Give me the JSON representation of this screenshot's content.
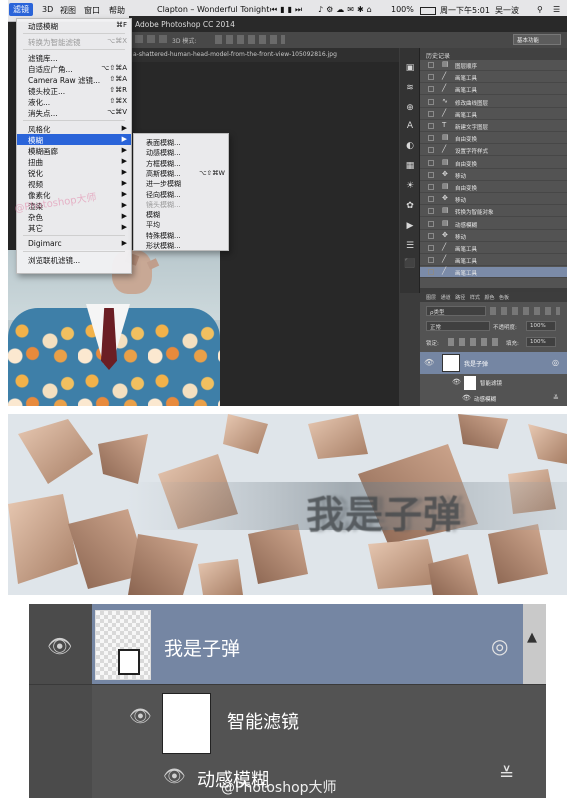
{
  "menubar": {
    "items": [
      "滤镜",
      "3D",
      "视图",
      "窗口",
      "帮助"
    ],
    "now_playing": "Clapton – Wonderful Tonight",
    "battery": "100%",
    "clock": "周一下午5:01",
    "user": "吴一波"
  },
  "window": {
    "title": "Adobe Photoshop CC 2014",
    "mode": "3D 模式:",
    "workspace": "基本功能",
    "doc_tab": "a-shattered-human-head-model-from-the-front-view-105092816.jpg"
  },
  "filter_menu": {
    "items": [
      {
        "label": "动感模糊",
        "shortcut": "⌘F",
        "state": "normal"
      },
      {
        "separator": true
      },
      {
        "label": "转换为智能滤镜",
        "shortcut": "⌥⌘X",
        "state": "disabled"
      },
      {
        "separator": true
      },
      {
        "label": "滤镜库...",
        "shortcut": "",
        "state": "normal"
      },
      {
        "label": "自适应广角...",
        "shortcut": "⌥⇧⌘A",
        "state": "normal"
      },
      {
        "label": "Camera Raw 滤镜...",
        "shortcut": "⇧⌘A",
        "state": "normal"
      },
      {
        "label": "镜头校正...",
        "shortcut": "⇧⌘R",
        "state": "normal"
      },
      {
        "label": "液化...",
        "shortcut": "⇧⌘X",
        "state": "normal"
      },
      {
        "label": "消失点...",
        "shortcut": "⌥⌘V",
        "state": "normal"
      },
      {
        "separator": true
      },
      {
        "label": "风格化",
        "shortcut": "▶",
        "state": "normal"
      },
      {
        "label": "模糊",
        "shortcut": "▶",
        "state": "highlighted"
      },
      {
        "label": "模糊画廊",
        "shortcut": "▶",
        "state": "normal"
      },
      {
        "label": "扭曲",
        "shortcut": "▶",
        "state": "normal"
      },
      {
        "label": "锐化",
        "shortcut": "▶",
        "state": "normal"
      },
      {
        "label": "视频",
        "shortcut": "▶",
        "state": "normal"
      },
      {
        "label": "像素化",
        "shortcut": "▶",
        "state": "normal"
      },
      {
        "label": "渲染",
        "shortcut": "▶",
        "state": "normal"
      },
      {
        "label": "杂色",
        "shortcut": "▶",
        "state": "normal"
      },
      {
        "label": "其它",
        "shortcut": "▶",
        "state": "normal"
      },
      {
        "separator": true
      },
      {
        "label": "Digimarc",
        "shortcut": "▶",
        "state": "normal"
      },
      {
        "separator": true
      },
      {
        "label": "浏览联机滤镜...",
        "shortcut": "",
        "state": "normal"
      }
    ]
  },
  "blur_submenu": {
    "items": [
      {
        "label": "表面模糊...",
        "shortcut": "",
        "state": "normal"
      },
      {
        "label": "动感模糊...",
        "shortcut": "",
        "state": "normal"
      },
      {
        "label": "方框模糊...",
        "shortcut": "",
        "state": "normal"
      },
      {
        "label": "高斯模糊...",
        "shortcut": "⌥⇧⌘W",
        "state": "normal"
      },
      {
        "label": "进一步模糊",
        "shortcut": "",
        "state": "normal"
      },
      {
        "label": "径向模糊...",
        "shortcut": "",
        "state": "normal"
      },
      {
        "label": "镜头模糊...",
        "shortcut": "",
        "state": "disabled"
      },
      {
        "label": "模糊",
        "shortcut": "",
        "state": "normal"
      },
      {
        "label": "平均",
        "shortcut": "",
        "state": "normal"
      },
      {
        "label": "特殊模糊...",
        "shortcut": "",
        "state": "normal"
      },
      {
        "label": "形状模糊...",
        "shortcut": "",
        "state": "normal"
      }
    ]
  },
  "history": {
    "title": "历史记录",
    "items": [
      {
        "label": "图层顺序",
        "icon": "layer-icon"
      },
      {
        "label": "画笔工具",
        "icon": "brush-icon"
      },
      {
        "label": "画笔工具",
        "icon": "brush-icon"
      },
      {
        "label": "修改曲线图层",
        "icon": "curve-icon"
      },
      {
        "label": "画笔工具",
        "icon": "brush-icon"
      },
      {
        "label": "新建文字图层",
        "icon": "text-icon"
      },
      {
        "label": "自由变换",
        "icon": "layer-icon"
      },
      {
        "label": "设置字符样式",
        "icon": "brush-icon"
      },
      {
        "label": "自由变换",
        "icon": "layer-icon"
      },
      {
        "label": "移动",
        "icon": "move-icon"
      },
      {
        "label": "自由变换",
        "icon": "layer-icon"
      },
      {
        "label": "移动",
        "icon": "move-icon"
      },
      {
        "label": "转换为智能对象",
        "icon": "layer-icon"
      },
      {
        "label": "动感模糊",
        "icon": "layer-icon"
      },
      {
        "label": "移动",
        "icon": "move-icon"
      },
      {
        "label": "画笔工具",
        "icon": "brush-icon"
      },
      {
        "label": "画笔工具",
        "icon": "brush-icon"
      },
      {
        "label": "画笔工具",
        "icon": "brush-icon",
        "selected": true
      }
    ]
  },
  "layers_panel": {
    "tabs": [
      "图层",
      "通道",
      "路径",
      "样式",
      "颜色",
      "色板"
    ],
    "filter_kind": "ρ类型",
    "blend_mode": "正常",
    "opacity_label": "不透明度:",
    "opacity": "100%",
    "lock_label": "锁定:",
    "fill_label": "填充:",
    "fill": "100%",
    "layers": [
      {
        "name": "我是子弹",
        "selected": true
      },
      {
        "name": "智能滤镜"
      },
      {
        "name": "动感模糊"
      }
    ]
  },
  "banner": {
    "text": "我是子弹"
  },
  "zoom_layers": {
    "layer": "我是子弹",
    "smart_filters": "智能滤镜",
    "filter": "动感模糊"
  },
  "watermark": "@Photoshop大师",
  "watermark_top": "@Photoshop大师",
  "colors": {
    "menu_highlight": "#2a64d9",
    "layer_selected": "#7586a3",
    "panel_bg": "#535353"
  }
}
